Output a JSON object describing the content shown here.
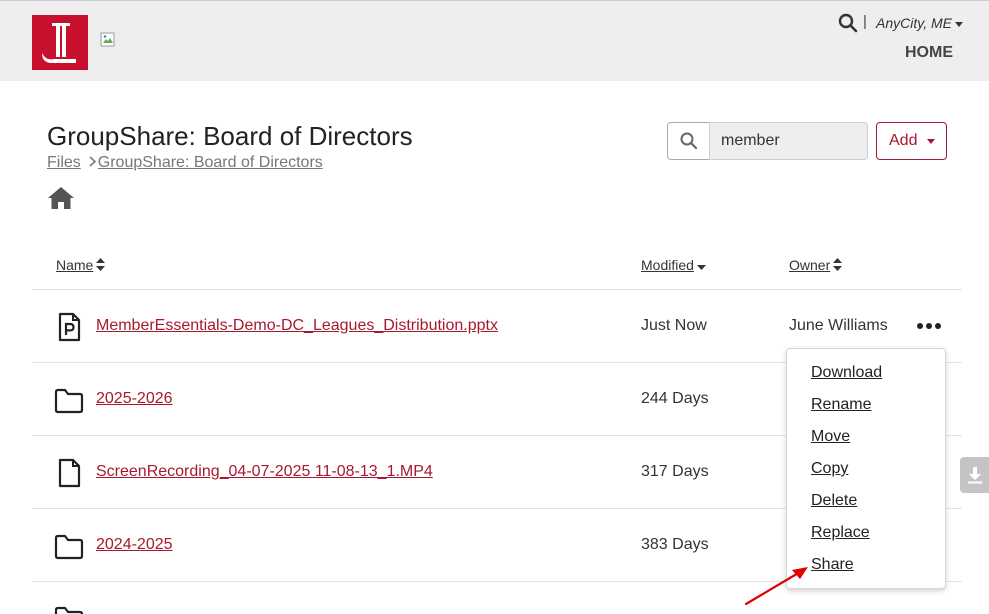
{
  "header": {
    "location": "AnyCity, ME",
    "separator": "|",
    "home_label": "HOME",
    "brand_color": "#c8102e"
  },
  "page": {
    "title": "GroupShare: Board of Directors",
    "breadcrumb": [
      "Files",
      "GroupShare: Board of Directors"
    ]
  },
  "search": {
    "value": "member"
  },
  "add_button": {
    "label": "Add"
  },
  "table": {
    "columns": {
      "name": "Name",
      "modified": "Modified",
      "owner": "Owner"
    },
    "rows": [
      {
        "icon": "powerpoint-file-icon",
        "name": "MemberEssentials-Demo-DC_Leagues_Distribution.pptx",
        "modified": "Just Now",
        "owner": "June Williams"
      },
      {
        "icon": "folder-icon",
        "name": "2025-2026",
        "modified": "244 Days",
        "owner": ""
      },
      {
        "icon": "file-icon",
        "name": "ScreenRecording_04-07-2025 11-08-13_1.MP4",
        "modified": "317 Days",
        "owner": ""
      },
      {
        "icon": "folder-icon",
        "name": "2024-2025",
        "modified": "383 Days",
        "owner": ""
      }
    ]
  },
  "context_menu": {
    "items": [
      "Download",
      "Rename",
      "Move",
      "Copy",
      "Delete",
      "Replace",
      "Share"
    ]
  },
  "colors": {
    "link": "#a6192e",
    "annotation_arrow": "#e00000"
  }
}
